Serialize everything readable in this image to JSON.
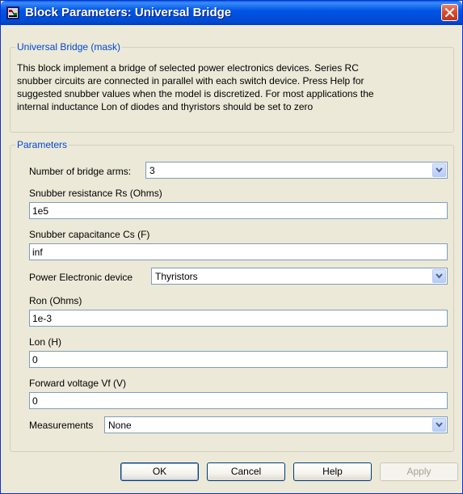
{
  "window": {
    "title": "Block Parameters: Universal Bridge"
  },
  "mask": {
    "legend": "Universal Bridge (mask)",
    "lines": [
      "This block implement a bridge of selected power electronics devices.  Series RC",
      "snubber circuits are connected in parallel with each switch device.  Press Help for",
      "suggested snubber values when the model is discretized. For most applications the",
      "internal inductance Lon of diodes and thyristors should be set to zero"
    ]
  },
  "parameters": {
    "legend": "Parameters",
    "arms": {
      "label": "Number of bridge arms:",
      "value": "3"
    },
    "rs": {
      "label": "Snubber resistance Rs (Ohms)",
      "value": "1e5"
    },
    "cs": {
      "label": "Snubber capacitance Cs (F)",
      "value": "inf"
    },
    "device": {
      "label": "Power Electronic device",
      "value": "Thyristors"
    },
    "ron": {
      "label": "Ron (Ohms)",
      "value": "1e-3"
    },
    "lon": {
      "label": "Lon (H)",
      "value": "0"
    },
    "vf": {
      "label": "Forward voltage Vf (V)",
      "value": "0"
    },
    "measurements": {
      "label": "Measurements",
      "value": "None"
    }
  },
  "buttons": {
    "ok": "OK",
    "cancel": "Cancel",
    "help": "Help",
    "apply": "Apply"
  },
  "icons": {
    "app": "simulink-block-icon",
    "close": "close-icon",
    "dropdown": "chevron-down-icon"
  },
  "colors": {
    "titlebar": "#0055e5",
    "legend_text": "#0046d5",
    "close_button": "#d84a2a",
    "dialog_bg": "#ece9d8"
  }
}
